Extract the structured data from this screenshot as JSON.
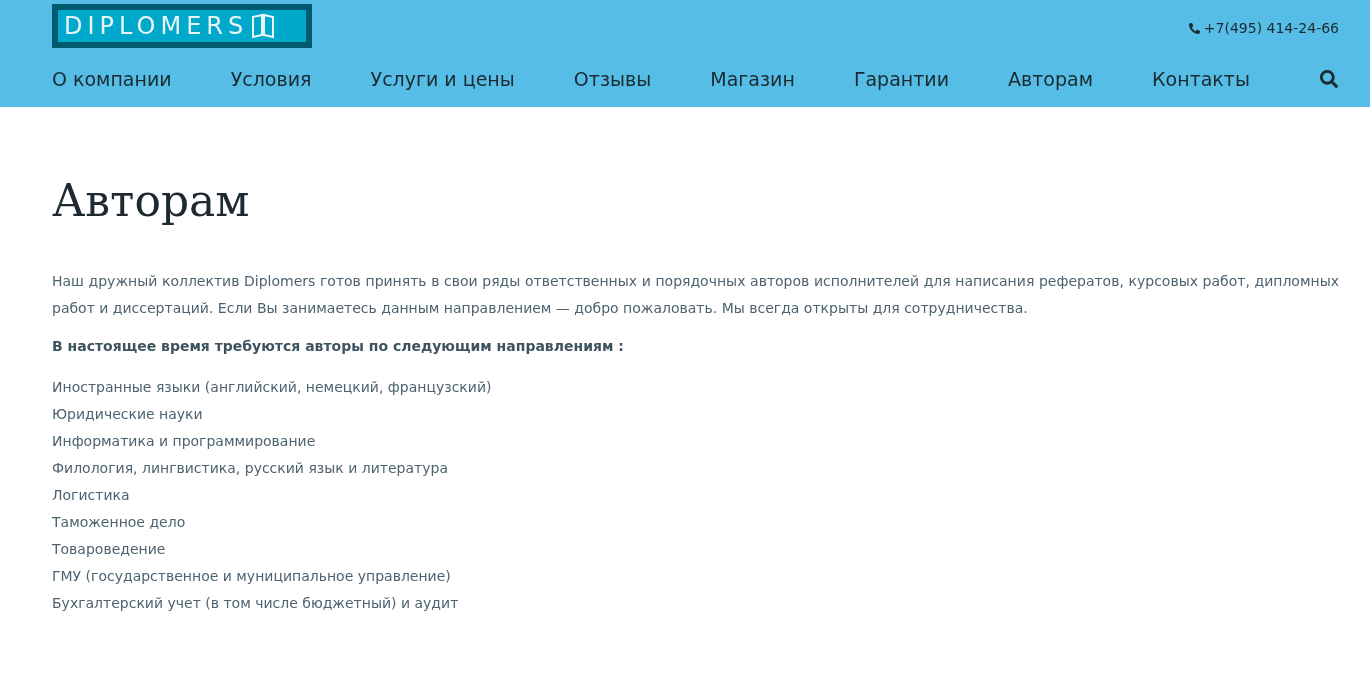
{
  "header": {
    "logo": "DIPLOMERS",
    "phone": "+7(495) 414-24-66",
    "nav": [
      "О компании",
      "Условия",
      "Услуги и цены",
      "Отзывы",
      "Магазин",
      "Гарантии",
      "Авторам",
      "Контакты"
    ]
  },
  "page": {
    "title": "Авторам",
    "intro": "Наш дружный коллектив Diplomers готов принять в свои ряды ответственных и порядочных авторов исполнителей для написания рефератов, курсовых работ, дипломных работ и диссертаций. Если Вы занимаетесь данным направлением — добро пожаловать. Мы всегда открыты для сотрудничества.",
    "subheading": "В настоящее время требуются авторы по следующим направлениям :",
    "directions": [
      "Иностранные языки (английский, немецкий, французский)",
      "Юридические науки",
      "Информатика и программирование",
      "Филология, лингвистика, русский язык и литература",
      "Логистика",
      "Таможенное дело",
      "Товароведение",
      "ГМУ (государственное и муниципальное управление)",
      "Бухгалтерский учет (в том числе бюджетный) и аудит"
    ]
  }
}
